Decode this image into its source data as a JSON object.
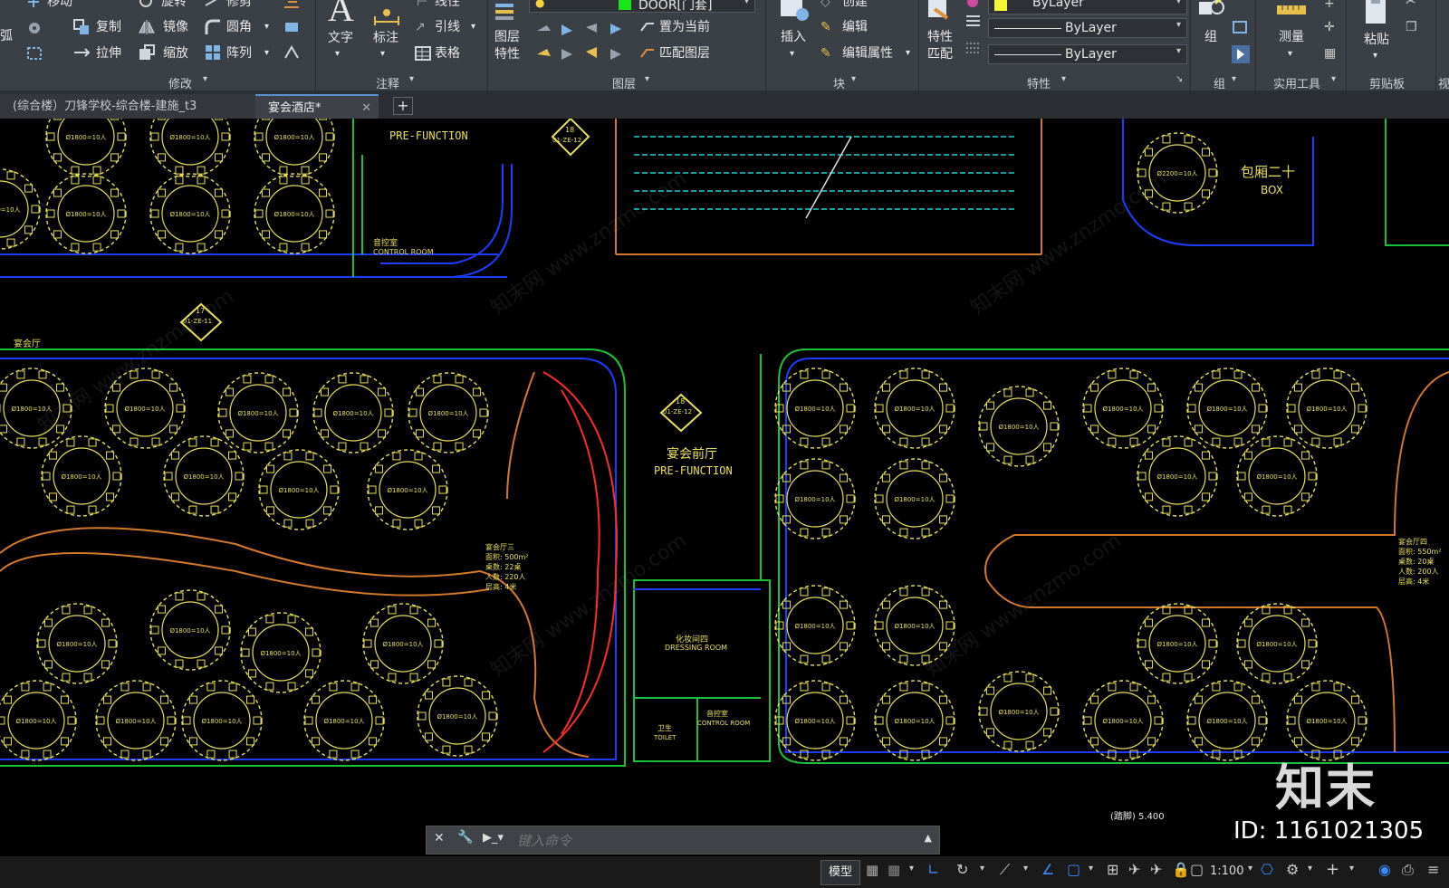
{
  "ribbon": {
    "modify": {
      "move": "移动",
      "rotate": "旋转",
      "trim": "修剪",
      "copy": "复制",
      "mirror": "镜像",
      "fillet": "圆角",
      "stretch": "拉伸",
      "scale": "缩放",
      "array": "阵列",
      "edge_label": "弧",
      "group": "修改"
    },
    "annotation": {
      "text": "文字",
      "dimension": "标注",
      "linear": "线性",
      "leader": "引线",
      "table": "表格",
      "group": "注释"
    },
    "layers": {
      "properties_l1": "图层",
      "properties_l2": "特性",
      "current_layer": "DOOR[门套]",
      "set_current": "置为当前",
      "match_layer": "匹配图层",
      "group": "图层"
    },
    "block": {
      "insert": "插入",
      "create": "创建",
      "edit": "编辑",
      "edit_attr": "编辑属性",
      "group": "块"
    },
    "properties": {
      "match_l1": "特性",
      "match_l2": "匹配",
      "color": "ByLayer",
      "linetype": "ByLayer",
      "lineweight": "ByLayer",
      "group": "特性"
    },
    "groups": {
      "group_btn": "组",
      "group": "组"
    },
    "utilities": {
      "measure": "测量",
      "group": "实用工具"
    },
    "clipboard": {
      "paste": "粘贴",
      "group": "剪贴板"
    },
    "view": {
      "label": "视"
    }
  },
  "tabs": [
    {
      "label": "(综合楼）刀锋学校-综合楼-建施_t3"
    },
    {
      "label": "宴会酒店*"
    }
  ],
  "drawing": {
    "pre_function_top": "PRE-FUNCTION",
    "control_room_cn": "音控室",
    "control_room_en": "CONTROL ROOM",
    "room_box_cn": "包厢二十",
    "room_box_en": "BOX",
    "banquet_hall_label": "宴会厅",
    "pre_function_cn": "宴会前厅",
    "pre_function_en": "PRE-FUNCTION",
    "hall3_title": "宴会厅三",
    "hall3_area": "面积: 500m²",
    "hall3_tables": "桌数: 22桌",
    "hall3_people": "人数: 220人",
    "hall3_height": "层高: 4米",
    "hall4_title": "宴会厅四",
    "hall4_area": "面积: 550m²",
    "hall4_tables": "桌数: 20桌",
    "hall4_people": "人数: 200人",
    "hall4_height": "层高: 4米",
    "dressing_cn": "化妆间四",
    "dressing_en": "DRESSING ROOM",
    "toilet_cn": "卫生",
    "toilet_en": "TOILET",
    "control_room2_cn": "音控室",
    "control_room2_en": "CONTROL ROOM",
    "tag1_num": "18",
    "tag1_code": "01-ZE-12",
    "tag2_num": "17",
    "tag2_code": "01-ZE-11",
    "tag3_num": "18",
    "tag3_code": "01-ZE-12",
    "table_label_a": "Ø1800=10人",
    "table_label_b": "Ø2200=10人",
    "dim_text": "(踏脚) 5.400",
    "watermark": "知末网 www.znzmo.com"
  },
  "command": {
    "placeholder": "键入命令"
  },
  "brand": {
    "logo": "知末",
    "id_text": "ID: 1161021305"
  },
  "status": {
    "model": "模型",
    "scale": "1:100"
  },
  "colors": {
    "ribbon": "#3b3f46",
    "canvas": "#000000",
    "wall": "#1e3cff",
    "furniture": "#e8e05a",
    "curve": "#d4782a",
    "stair": "#ff2a2a",
    "cyan": "#19d6d6",
    "green": "#19c23a"
  }
}
